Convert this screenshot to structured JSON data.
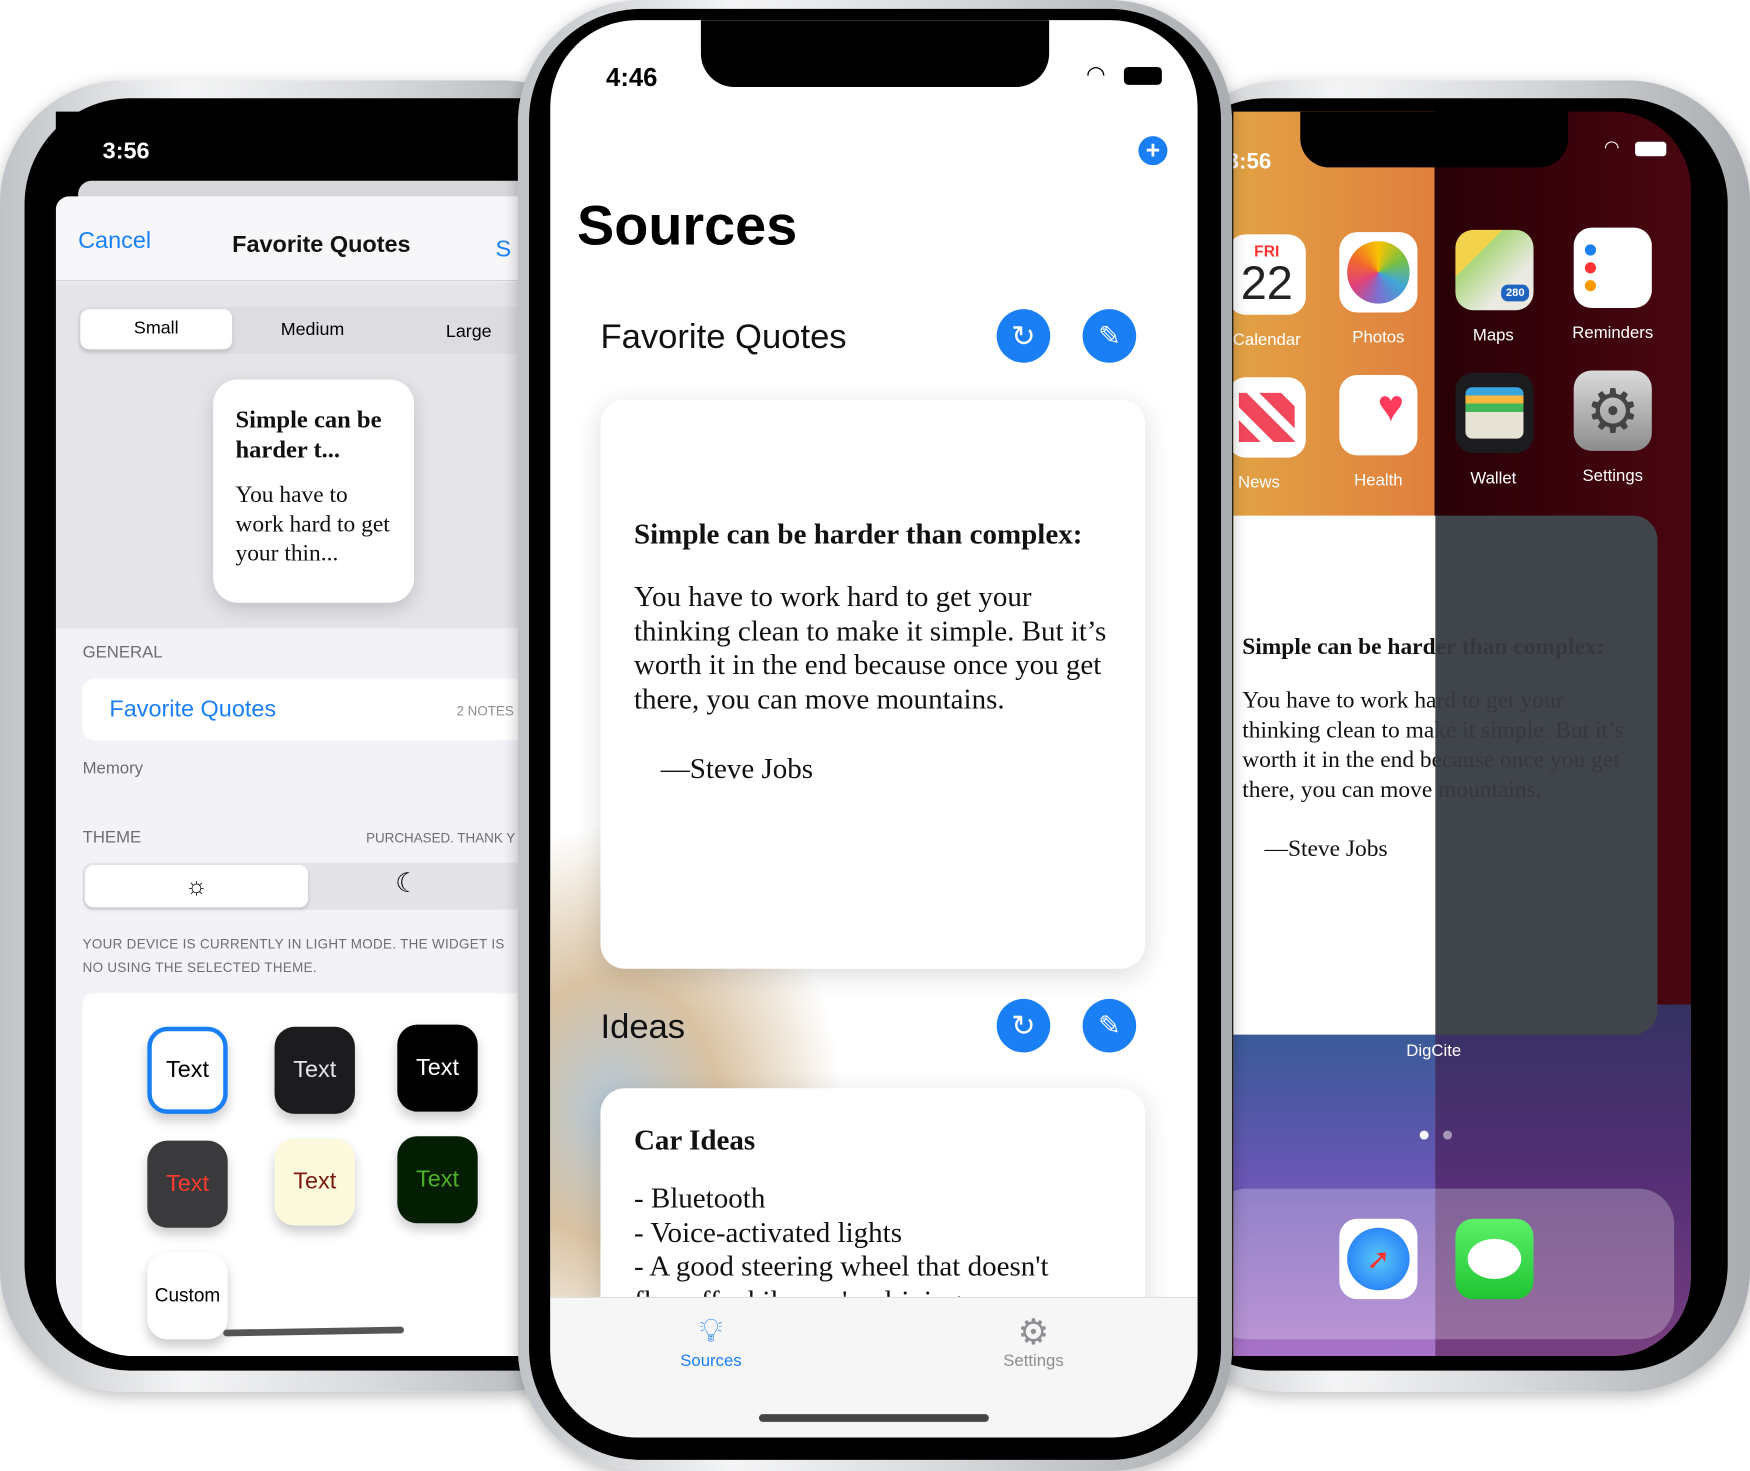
{
  "left_phone": {
    "status_time": "3:56",
    "sheet": {
      "cancel_label": "Cancel",
      "title": "Favorite Quotes",
      "save_label": "S"
    },
    "size_segments": [
      {
        "label": "Small",
        "selected": true
      },
      {
        "label": "Medium",
        "selected": false
      },
      {
        "label": "Large",
        "selected": false
      }
    ],
    "preview": {
      "title": "Simple can be harder t...",
      "body": "You have to work hard to get your thin..."
    },
    "general": {
      "header": "GENERAL",
      "source_label": "Favorite Quotes",
      "source_count": "2 NOTES",
      "footer": "Memory"
    },
    "theme": {
      "header": "THEME",
      "status": "PURCHASED. THANK Y",
      "options": [
        {
          "icon": "sun-icon",
          "selected": true
        },
        {
          "icon": "moon-icon",
          "selected": false
        }
      ],
      "footer": "YOUR DEVICE IS CURRENTLY IN LIGHT MODE. THE WIDGET IS NO USING THE SELECTED THEME."
    },
    "styles": [
      {
        "label": "Text",
        "bg": "#ffffff",
        "fg": "#000000",
        "selected": true
      },
      {
        "label": "Text",
        "bg": "#1c1c1e",
        "fg": "#e5e5ea",
        "selected": false
      },
      {
        "label": "Text",
        "bg": "#000000",
        "fg": "#ffffff",
        "selected": false
      },
      {
        "label": "Text",
        "bg": "#3a3a3c",
        "fg": "#ff3b30",
        "selected": false
      },
      {
        "label": "Text",
        "bg": "#fdf9dc",
        "fg": "#7a1a10",
        "selected": false
      },
      {
        "label": "Text",
        "bg": "#041e04",
        "fg": "#4caf27",
        "selected": false
      },
      {
        "label": "Custom",
        "bg": "#ffffff",
        "fg": "#000000",
        "selected": false
      }
    ]
  },
  "center_phone": {
    "status_time": "4:46",
    "title": "Sources",
    "sections": [
      {
        "name": "Favorite Quotes",
        "card_title": "Simple can be harder than complex:",
        "card_body": "You have to work hard to get your thinking clean to make it simple. But it’s worth it in the end because once you get there, you can move mountains.",
        "card_attribution": "—Steve Jobs"
      },
      {
        "name": "Ideas",
        "card_title": "Car Ideas",
        "card_lines": [
          "- Bluetooth",
          "- Voice-activated lights",
          "- A good steering wheel that doesn't",
          "flap off while you're driving"
        ]
      }
    ],
    "tabs": [
      {
        "label": "Sources",
        "icon": "lightbulb-icon",
        "active": true
      },
      {
        "label": "Settings",
        "icon": "gear-icon",
        "active": false
      }
    ],
    "accent": "#1a7ff5"
  },
  "right_phone": {
    "status_time": "3:56",
    "calendar": {
      "day": "FRI",
      "date": "22"
    },
    "apps": [
      "Calendar",
      "Photos",
      "Maps",
      "Reminders",
      "News",
      "Health",
      "Wallet",
      "Settings"
    ],
    "maps_badge": "280",
    "widget": {
      "title": "Simple can be harder than complex:",
      "body": "You have to work hard to get your thinking clean to make it simple. But it’s worth it in the end because once you get there, you can move mountains.",
      "attribution": "—Steve Jobs",
      "app_name": "DigCite"
    },
    "dock": [
      "safari-icon",
      "messages-icon"
    ]
  }
}
